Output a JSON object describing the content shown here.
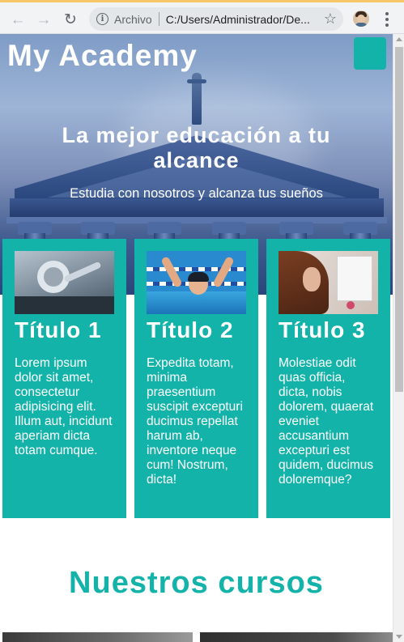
{
  "browser": {
    "back_icon": "arrow-left-icon",
    "forward_icon": "arrow-right-icon",
    "reload_icon": "reload-icon",
    "security_label": "Archivo",
    "url": "C:/Users/Administrador/De...",
    "bookmark_icon": "star-icon",
    "menu_icon": "more-vert-icon"
  },
  "header": {
    "logo": "My Academy",
    "menu_button_color": "#14b3aa"
  },
  "hero": {
    "title": "La mejor educación a tu alcance",
    "subtitle": "Estudia con nosotros y alcanza tus sueños"
  },
  "cards": [
    {
      "title": "Título 1",
      "text": "Lorem ipsum dolor sit amet, consectetur adipisicing elit. Illum aut, incidunt aperiam dicta totam cumque."
    },
    {
      "title": "Título 2",
      "text": "Expedita totam, minima praesentium suscipit excepturi ducimus repellat harum ab, inventore neque cum! Nostrum, dicta!"
    },
    {
      "title": "Título 3",
      "text": "Molestiae odit quas officia, dicta, nobis dolorem, quaerat eveniet accusantium excepturi est quidem, ducimus doloremque?"
    }
  ],
  "courses": {
    "title": "Nuestros cursos"
  },
  "theme": {
    "accent": "#14b3aa",
    "chrome_background": "#f1f3f4"
  }
}
